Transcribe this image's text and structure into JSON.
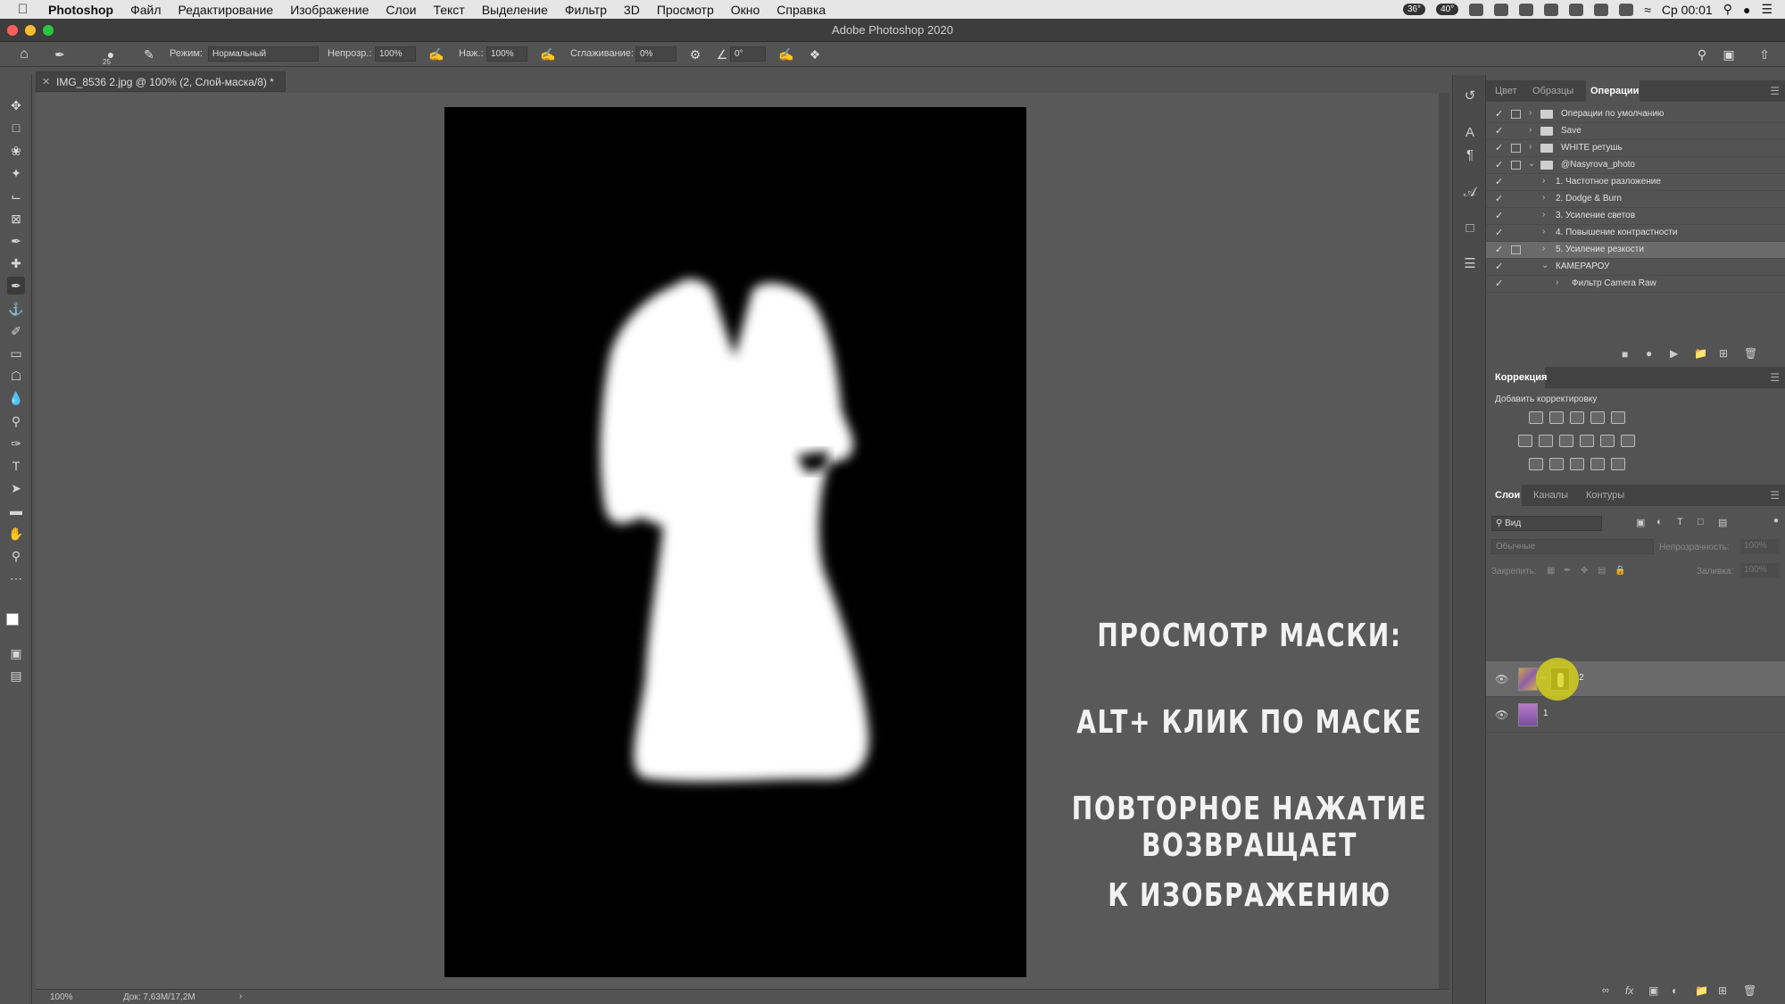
{
  "menubar": {
    "items": [
      "Photoshop",
      "Файл",
      "Редактирование",
      "Изображение",
      "Слои",
      "Текст",
      "Выделение",
      "Фильтр",
      "3D",
      "Просмотр",
      "Окно",
      "Справка"
    ],
    "temp1": "36°",
    "temp2": "40°",
    "clock": "Ср 00:01"
  },
  "window": {
    "title": "Adobe Photoshop 2020"
  },
  "options": {
    "brush_size": "25",
    "mode_label": "Режим:",
    "mode_value": "Нормальный",
    "opacity_label": "Непрозр.:",
    "opacity_value": "100%",
    "pressure_label": "Наж.:",
    "pressure_value": "100%",
    "smoothing_label": "Сглаживание:",
    "smoothing_value": "0%",
    "angle_value": "0°"
  },
  "document": {
    "tab_title": "IMG_8536 2.jpg @ 100% (2, Слой-маска/8) *",
    "zoom": "100%",
    "doc_info": "Док: 7,63M/17,2M"
  },
  "actions_panel": {
    "tabs": [
      "Цвет",
      "Образцы",
      "Операции"
    ],
    "rows": [
      {
        "label": "Операции по умолчанию",
        "level": 0,
        "folder": true
      },
      {
        "label": "Save",
        "level": 0,
        "folder": true
      },
      {
        "label": "WHITE  ретушь",
        "level": 0,
        "folder": true
      },
      {
        "label": "@Nasyrova_photo",
        "level": 0,
        "folder": true
      },
      {
        "label": "1. Частотное разложение",
        "level": 1,
        "folder": false
      },
      {
        "label": "2. Dodge & Burn",
        "level": 1,
        "folder": false
      },
      {
        "label": "3. Усиление светов",
        "level": 1,
        "folder": false
      },
      {
        "label": "4. Повышение контрастности",
        "level": 1,
        "folder": false
      },
      {
        "label": "5. Усиление резкости",
        "level": 1,
        "folder": false
      },
      {
        "label": "КАМЕРАРОУ",
        "level": 1,
        "folder": false
      },
      {
        "label": "Фильтр Camera Raw",
        "level": 2,
        "folder": false
      }
    ]
  },
  "adjustments_panel": {
    "title": "Коррекция",
    "subtitle": "Добавить корректировку"
  },
  "layers_panel": {
    "tabs": [
      "Слои",
      "Каналы",
      "Контуры"
    ],
    "filter_placeholder": "Вид",
    "blend_mode": "Обычные",
    "opacity_label": "Непрозрачность:",
    "opacity_value": "100%",
    "lock_label": "Закрепить:",
    "fill_label": "Заливка:",
    "fill_value": "100%",
    "layers": [
      {
        "name": "2",
        "has_mask": true
      },
      {
        "name": "1",
        "has_mask": false
      }
    ]
  },
  "caption": {
    "line1": "Просмотр маски:",
    "line2": "ALT+ клик по маске",
    "line3": "Повторное нажатие возвращает",
    "line4": "к изображению"
  },
  "colors": {
    "highlight": "#d8d31a"
  }
}
